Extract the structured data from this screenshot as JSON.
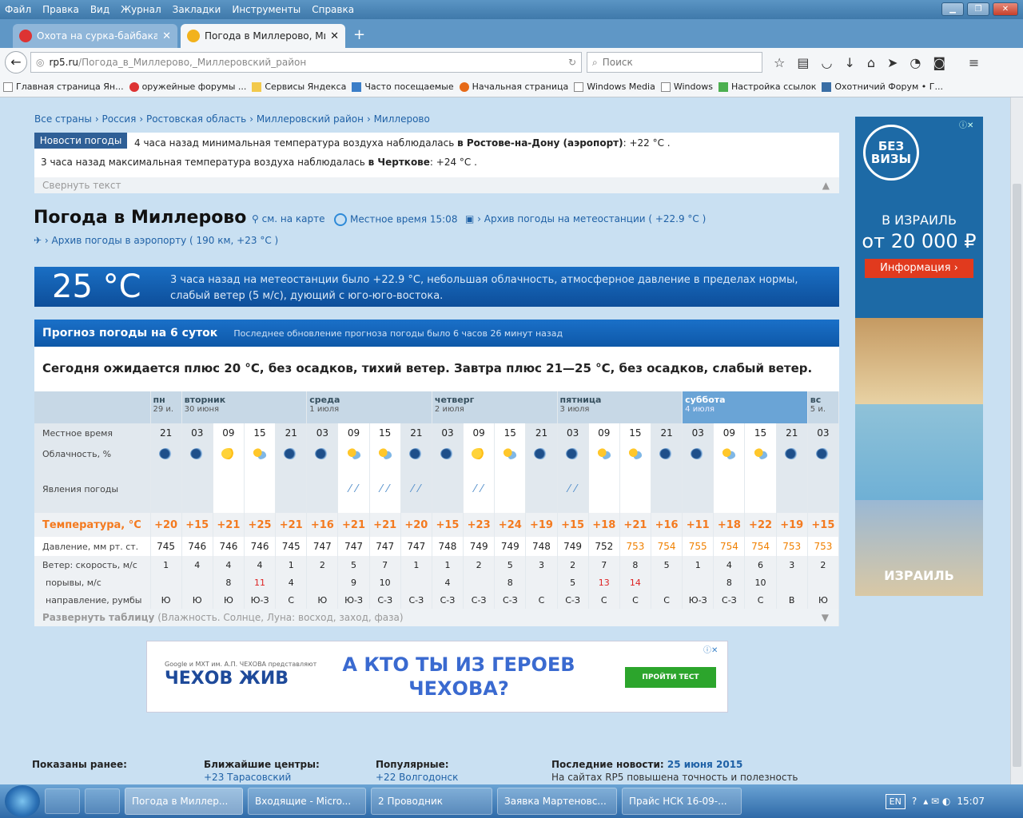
{
  "browser": {
    "menu": [
      "Файл",
      "Правка",
      "Вид",
      "Журнал",
      "Закладки",
      "Инструменты",
      "Справка"
    ],
    "tabs": [
      {
        "label": "Охота на сурка-байбака с...",
        "active": false
      },
      {
        "label": "Погода в Миллерово, Ми...",
        "active": true
      }
    ],
    "url_domain": "rp5.ru",
    "url_path": "/Погода_в_Миллерово,_Миллеровский_район",
    "search_placeholder": "Поиск",
    "bookmarks": [
      "Главная страница Ян...",
      "оружейные форумы ...",
      "Сервисы Яндекса",
      "Часто посещаемые",
      "Начальная страница",
      "Windows Media",
      "Windows",
      "Настройка ссылок",
      "Охотничий Форум • Г..."
    ]
  },
  "page": {
    "breadcrumbs": [
      "Все страны",
      "Россия",
      "Ростовская область",
      "Миллеровский район",
      "Миллерово"
    ],
    "news": {
      "label": "Новости погоды",
      "line1_pre": "4 часа назад минимальная температура воздуха наблюдалась ",
      "line1_place": "в Ростове-на-Дону (аэропорт)",
      "line1_post": ": +22 °C .",
      "line2_pre": "3 часа назад максимальная температура воздуха наблюдалась ",
      "line2_place": "в Черткове",
      "line2_post": ": +24 °C .",
      "collapse": "Свернуть текст"
    },
    "title": "Погода в Миллерово",
    "on_map": "см. на карте",
    "local_time": "Местное время  15:08",
    "station_archive": "› Архив погоды на метеостанции ( +22.9 °C )",
    "airport_archive": "› Архив погоды в аэропорту ( 190 км, +23 °C )",
    "current": {
      "temp": "25 °C",
      "text": "3 часа назад на метеостанции было +22.9 °С, небольшая облачность, атмосферное давление в пределах нормы, слабый ветер (5 м/с), дующий с юго-юго-востока."
    },
    "forecast": {
      "title": "Прогноз погоды на 6 суток",
      "updated": "Последнее обновление прогноза погоды было 6 часов 26 минут назад",
      "summary": "Сегодня ожидается плюс 20 °С, без осадков, тихий ветер. Завтра плюс 21—25 °С, без осадков, слабый ветер.",
      "labels": {
        "time": "Местное время",
        "cloud": "Облачность, %",
        "phen": "Явления погоды",
        "temp": "Температура, °С",
        "pres": "Давление, мм рт. ст.",
        "wind": "Ветер: скорость, м/с",
        "gust": "порывы, м/с",
        "dir": "направление, румбы"
      },
      "days": [
        {
          "name": "пн",
          "date": "29 и.",
          "span": 1,
          "sat": false
        },
        {
          "name": "вторник",
          "date": "30 июня",
          "span": 4,
          "sat": false
        },
        {
          "name": "среда",
          "date": "1 июля",
          "span": 4,
          "sat": false
        },
        {
          "name": "четверг",
          "date": "2 июля",
          "span": 4,
          "sat": false
        },
        {
          "name": "пятница",
          "date": "3 июля",
          "span": 4,
          "sat": false
        },
        {
          "name": "суббота",
          "date": "4 июля",
          "span": 4,
          "sat": true
        },
        {
          "name": "вс",
          "date": "5 и.",
          "span": 1,
          "sat": false
        }
      ],
      "times": [
        "21",
        "03",
        "09",
        "15",
        "21",
        "03",
        "09",
        "15",
        "21",
        "03",
        "09",
        "15",
        "21",
        "03",
        "09",
        "15",
        "21",
        "03",
        "09",
        "15",
        "21",
        "03"
      ],
      "daylight": [
        false,
        false,
        true,
        true,
        false,
        false,
        true,
        true,
        false,
        false,
        true,
        true,
        false,
        false,
        true,
        true,
        false,
        false,
        true,
        true,
        false,
        false
      ],
      "clouds": [
        "night",
        "night",
        "sun",
        "part",
        "night",
        "night",
        "part",
        "part",
        "night",
        "night",
        "sun",
        "part",
        "night",
        "night",
        "part",
        "part",
        "night",
        "night",
        "part",
        "part",
        "night",
        "night"
      ],
      "phen": [
        "",
        "",
        "",
        "",
        "",
        "",
        "rain",
        "rain",
        "rain",
        "",
        "rain",
        "",
        "",
        "rain",
        "",
        "",
        "",
        "",
        "",
        "",
        "",
        ""
      ],
      "temps": [
        "+20",
        "+15",
        "+21",
        "+25",
        "+21",
        "+16",
        "+21",
        "+21",
        "+20",
        "+15",
        "+23",
        "+24",
        "+19",
        "+15",
        "+18",
        "+21",
        "+16",
        "+11",
        "+18",
        "+22",
        "+19",
        "+15"
      ],
      "pressure": [
        "745",
        "746",
        "746",
        "746",
        "745",
        "747",
        "747",
        "747",
        "747",
        "748",
        "749",
        "749",
        "748",
        "749",
        "752",
        "753",
        "754",
        "755",
        "754",
        "754",
        "753",
        "753"
      ],
      "pressure_high": [
        false,
        false,
        false,
        false,
        false,
        false,
        false,
        false,
        false,
        false,
        false,
        false,
        false,
        false,
        false,
        true,
        true,
        true,
        true,
        true,
        true,
        true
      ],
      "wind": [
        "1",
        "4",
        "4",
        "4",
        "1",
        "2",
        "5",
        "7",
        "1",
        "1",
        "2",
        "5",
        "3",
        "2",
        "7",
        "8",
        "5",
        "1",
        "4",
        "6",
        "3",
        "2"
      ],
      "gust": [
        "",
        "",
        "8",
        "11",
        "4",
        "",
        "9",
        "10",
        "",
        "4",
        "",
        "8",
        "",
        "5",
        "13",
        "14",
        "",
        "",
        "8",
        "10",
        "",
        ""
      ],
      "gust_red": [
        false,
        false,
        false,
        true,
        false,
        false,
        false,
        false,
        false,
        false,
        false,
        false,
        false,
        false,
        true,
        true,
        false,
        false,
        false,
        false,
        false,
        false
      ],
      "dir": [
        "Ю",
        "Ю",
        "Ю",
        "Ю-З",
        "С",
        "Ю",
        "Ю-З",
        "С-З",
        "С-З",
        "С-З",
        "С-З",
        "С-З",
        "С",
        "С-З",
        "С",
        "С",
        "С",
        "Ю-З",
        "С-З",
        "С",
        "В",
        "Ю"
      ],
      "expand_bold": "Развернуть таблицу",
      "expand_rest": " (Влажность. Солнце, Луна: восход, заход, фаза)"
    },
    "ads": {
      "right_badge": "БЕЗ ВИЗЫ",
      "right_line1": "В ИЗРАИЛЬ",
      "right_line2": "от 20 000 ₽",
      "right_btn": "Информация ›",
      "right_logo": "ИЗРАИЛЬ",
      "bottom_small": "Google и МХТ им. А.П. ЧЕХОВА представляют",
      "bottom_left": "ЧЕХОВ ЖИВ",
      "bottom_mid": "А КТО ТЫ ИЗ ГЕРОЕВ ЧЕХОВА?",
      "bottom_btn": "ПРОЙТИ ТЕСТ"
    },
    "bottom": {
      "shown": "Показаны ранее:",
      "centers": "Ближайшие центры:",
      "centers_first": "+23  Тарасовский",
      "popular": "Популярные:",
      "popular_first": "+22  Волгодонск",
      "news_label": "Последние новости:",
      "news_date": "25 июня 2015",
      "news_text": "На сайтах RP5 повышена точность и полезность прогнозов"
    }
  },
  "taskbar": {
    "items": [
      "Погода в Миллер...",
      "Входящие - Micro...",
      "2 Проводник",
      "Заявка Мартеновс...",
      "Прайс НСК 16-09-..."
    ],
    "lang": "EN",
    "clock": "15:07"
  },
  "colors": {
    "accent": "#1a6fc4",
    "temp": "#f47a1f",
    "link": "#1f61a6"
  }
}
